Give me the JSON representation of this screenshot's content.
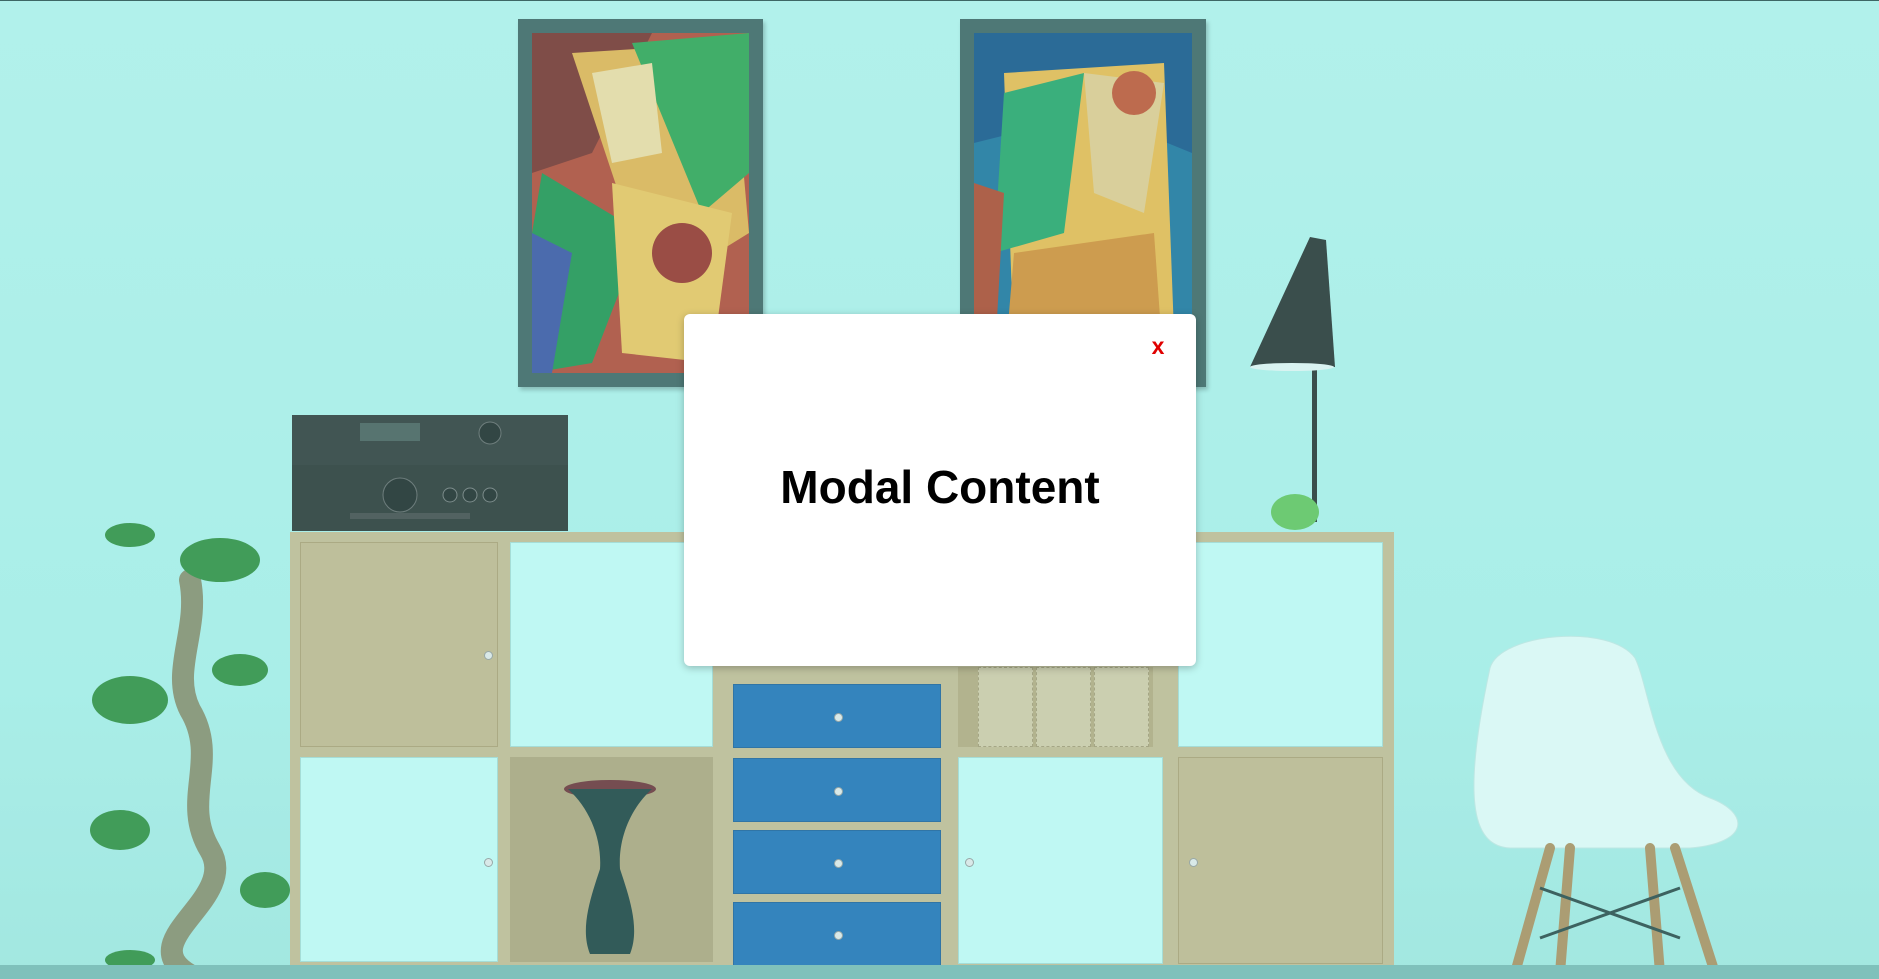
{
  "modal": {
    "title": "Modal Content",
    "close_label": "x"
  },
  "background": {
    "scene": "living-room-sideboard-photo",
    "tint": "#b3efe8",
    "icons": [
      "painting-icon",
      "stereo-icon",
      "lamp-icon",
      "bonsai-plant-icon",
      "vase-icon",
      "chair-icon"
    ]
  },
  "colors": {
    "close": "#e00000",
    "modal_bg": "#ffffff",
    "drawer_blue": "#1f6db4"
  }
}
